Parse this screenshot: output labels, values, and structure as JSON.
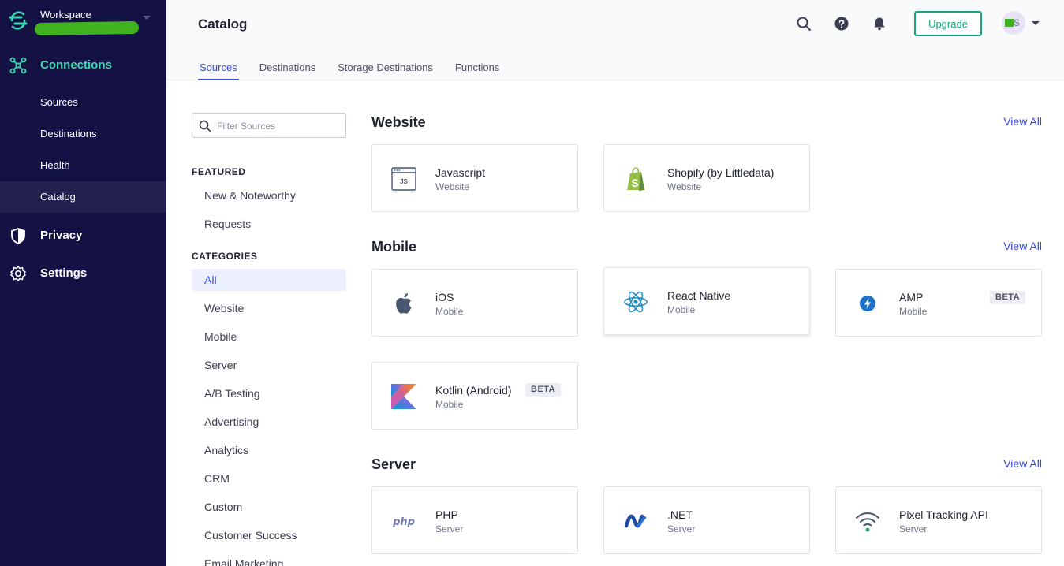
{
  "workspace": {
    "label": "Workspace"
  },
  "nav": {
    "connections": "Connections",
    "sub": [
      "Sources",
      "Destinations",
      "Health",
      "Catalog"
    ],
    "privacy": "Privacy",
    "settings": "Settings"
  },
  "header": {
    "title": "Catalog",
    "upgrade": "Upgrade",
    "avatar_initial": "S",
    "tabs": [
      "Sources",
      "Destinations",
      "Storage Destinations",
      "Functions"
    ]
  },
  "filter": {
    "placeholder": "Filter Sources",
    "featured_heading": "FEATURED",
    "featured": [
      "New & Noteworthy",
      "Requests"
    ],
    "categories_heading": "CATEGORIES",
    "categories": [
      "All",
      "Website",
      "Mobile",
      "Server",
      "A/B Testing",
      "Advertising",
      "Analytics",
      "CRM",
      "Custom",
      "Customer Success",
      "Email Marketing"
    ]
  },
  "catalog": {
    "view_all": "View All",
    "sections": [
      {
        "title": "Website",
        "items": [
          {
            "name": "Javascript",
            "category": "Website",
            "icon": "javascript-icon"
          },
          {
            "name": "Shopify (by Littledata)",
            "category": "Website",
            "icon": "shopify-icon"
          }
        ]
      },
      {
        "title": "Mobile",
        "items": [
          {
            "name": "iOS",
            "category": "Mobile",
            "icon": "apple-icon"
          },
          {
            "name": "React Native",
            "category": "Mobile",
            "icon": "react-icon"
          },
          {
            "name": "AMP",
            "category": "Mobile",
            "badge": "BETA",
            "icon": "amp-icon"
          },
          {
            "name": "Kotlin (Android)",
            "category": "Mobile",
            "badge": "BETA",
            "icon": "kotlin-icon"
          }
        ]
      },
      {
        "title": "Server",
        "items": [
          {
            "name": "PHP",
            "category": "Server",
            "icon": "php-icon"
          },
          {
            "name": ".NET",
            "category": "Server",
            "icon": "dotnet-icon"
          },
          {
            "name": "Pixel Tracking API",
            "category": "Server",
            "icon": "wifi-icon"
          }
        ]
      }
    ]
  },
  "colors": {
    "sidebar": "#141245",
    "accent": "#3a4bd6",
    "connections": "#3ed9b2",
    "upgrade": "#16a77d"
  }
}
